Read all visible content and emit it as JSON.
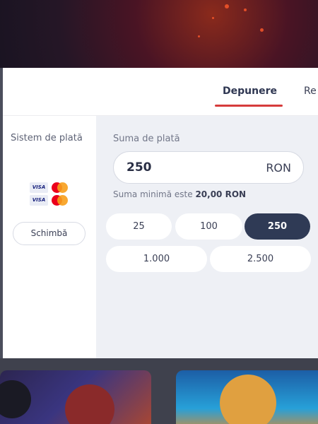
{
  "tabs": {
    "active_label": "Depunere",
    "other_label": "Re"
  },
  "sidebar": {
    "title": "Sistem de plată",
    "payment_methods": [
      "VISA",
      "VISA"
    ],
    "change_label": "Schimbă"
  },
  "amount": {
    "label": "Suma de plată",
    "value": "250",
    "currency": "RON",
    "min_prefix": "Suma minimă este ",
    "min_value": "20,00 RON"
  },
  "presets": [
    {
      "label": "25",
      "selected": false
    },
    {
      "label": "100",
      "selected": false
    },
    {
      "label": "250",
      "selected": true
    },
    {
      "label": "1.000",
      "selected": false
    },
    {
      "label": "2.500",
      "selected": false
    }
  ],
  "colors": {
    "accent": "#d63b3b",
    "selected_chip": "#2f3a55",
    "panel_bg": "#eef0f5"
  }
}
